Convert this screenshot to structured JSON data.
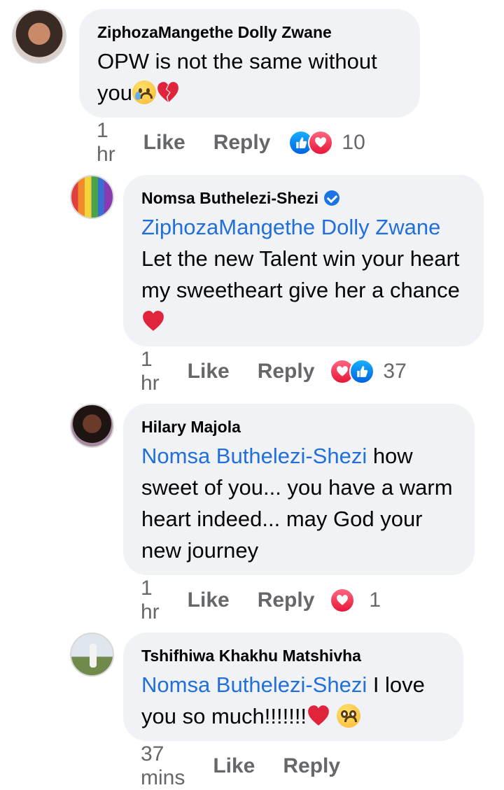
{
  "comments": [
    {
      "author": "ZiphozaMangethe Dolly Zwane",
      "text": "OPW is not the same without you",
      "emojis": [
        "crying-face",
        "broken-heart"
      ],
      "time": "1 hr",
      "like_label": "Like",
      "reply_label": "Reply",
      "reactions": [
        "like",
        "love"
      ],
      "reaction_count": "10"
    },
    {
      "author": "Nomsa Buthelezi-Shezi",
      "verified": true,
      "mention": "ZiphozaMangethe Dolly Zwane",
      "text": "Let the new Talent win your heart my sweetheart give her a chance",
      "emojis": [
        "red-heart"
      ],
      "time": "1 hr",
      "like_label": "Like",
      "reply_label": "Reply",
      "reactions": [
        "love",
        "like"
      ],
      "reaction_count": "37"
    },
    {
      "author": "Hilary Majola",
      "mention": "Nomsa Buthelezi-Shezi",
      "text": " how sweet of you... you have a warm heart indeed... may God your new journey",
      "time": "1 hr",
      "like_label": "Like",
      "reply_label": "Reply",
      "reactions": [
        "love"
      ],
      "reaction_count": "1"
    },
    {
      "author": "Tshifhiwa Khakhu Matshivha",
      "mention": "Nomsa Buthelezi-Shezi",
      "text": " I love you so much!!!!!!!",
      "emojis": [
        "red-heart",
        "pleading-face"
      ],
      "time": "37 mins",
      "like_label": "Like",
      "reply_label": "Reply"
    }
  ],
  "colors": {
    "bubble": "#f0f2f5",
    "mention": "#216fdb",
    "meta": "#65676b",
    "like": "#1877f2",
    "love": "#f33e58"
  }
}
